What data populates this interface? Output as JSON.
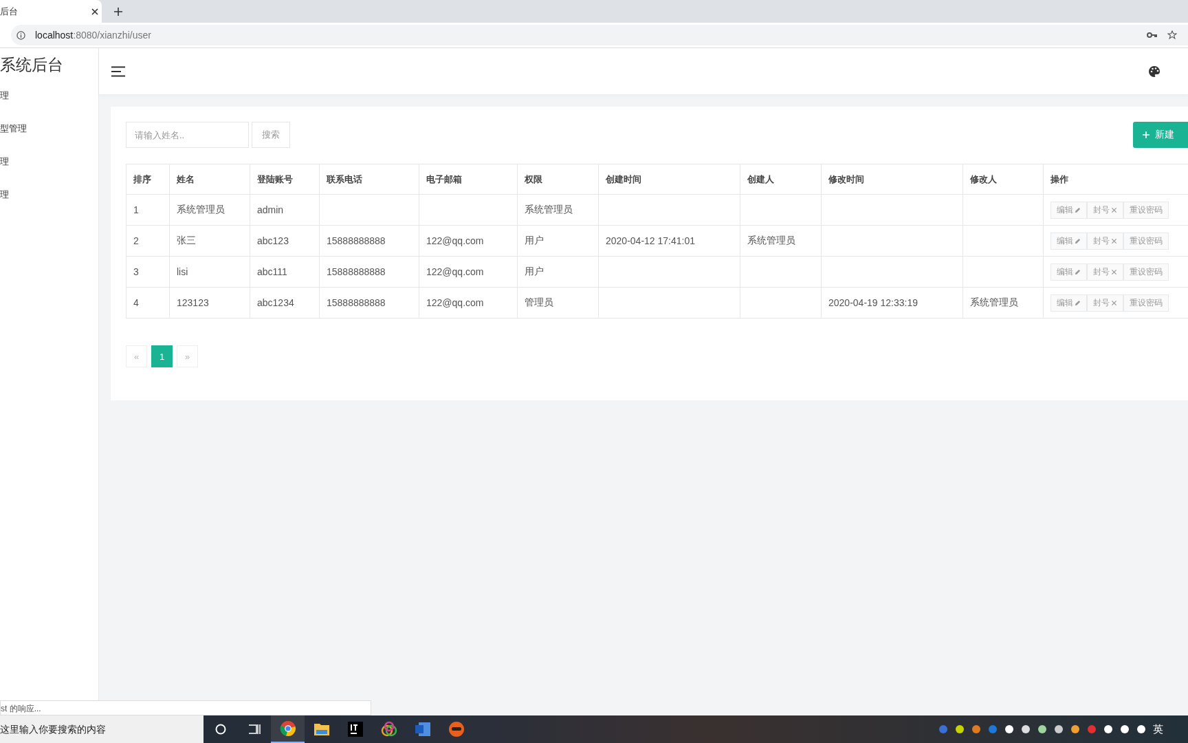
{
  "browser": {
    "tab": {
      "title": "后台"
    },
    "url": {
      "host": "localhost",
      "path": ":8080/xianzhi/user"
    }
  },
  "sidebar": {
    "title": "系统后台",
    "items": [
      {
        "label": "理",
        "selected": false
      },
      {
        "label": "型管理",
        "selected": false
      },
      {
        "label": "理",
        "selected": false
      },
      {
        "label": "理",
        "selected": false
      }
    ]
  },
  "search": {
    "placeholder": "请输入姓名..",
    "button": "搜索"
  },
  "new_button": "新建",
  "table": {
    "columns": [
      "排序",
      "姓名",
      "登陆账号",
      "联系电话",
      "电子邮箱",
      "权限",
      "创建时间",
      "创建人",
      "修改时间",
      "修改人",
      "操作"
    ],
    "rows": [
      {
        "cells": [
          "1",
          "系统管理员",
          "admin",
          "",
          "",
          "系统管理员",
          "",
          "",
          "",
          "",
          ""
        ],
        "actions": [
          "编辑",
          "封号",
          "重设密码"
        ]
      },
      {
        "cells": [
          "2",
          "张三",
          "abc123",
          "15888888888",
          "122@qq.com",
          "用户",
          "2020-04-12 17:41:01",
          "系统管理员",
          "",
          ""
        ],
        "actions": [
          "编辑",
          "封号",
          "重设密码"
        ]
      },
      {
        "cells": [
          "3",
          "lisi",
          "abc111",
          "15888888888",
          "122@qq.com",
          "用户",
          "",
          "",
          "",
          ""
        ],
        "actions": [
          "编辑",
          "封号",
          "重设密码"
        ]
      },
      {
        "cells": [
          "4",
          "123123",
          "abc1234",
          "15888888888",
          "122@qq.com",
          "管理员",
          "",
          "",
          "2020-04-19 12:33:19",
          "系统管理员"
        ],
        "actions": [
          "编辑",
          "封号",
          "重设密码"
        ]
      }
    ]
  },
  "pagination": {
    "prev": "«",
    "next": "»",
    "pages": [
      {
        "label": "1",
        "selected": true
      }
    ]
  },
  "status_bar": "st 的响应...",
  "taskbar": {
    "search_placeholder": "这里输入你要搜索的内容",
    "ime": "英"
  }
}
